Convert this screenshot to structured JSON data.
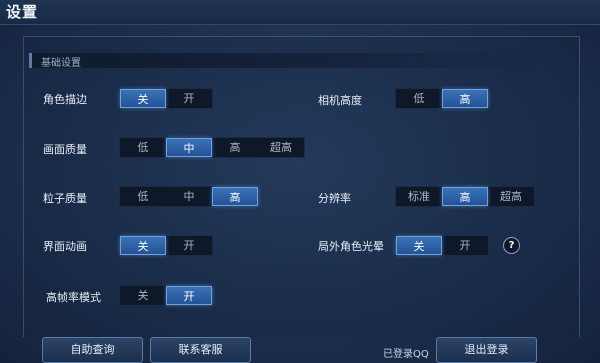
{
  "header": {
    "title": "设置"
  },
  "section": {
    "title": "基础设置"
  },
  "settings": {
    "character_outline": {
      "label": "角色描边",
      "options": [
        "关",
        "开"
      ],
      "selected": "关"
    },
    "camera_height": {
      "label": "相机高度",
      "options": [
        "低",
        "高"
      ],
      "selected": "高"
    },
    "image_quality": {
      "label": "画面质量",
      "options": [
        "低",
        "中",
        "高",
        "超高"
      ],
      "selected": "中"
    },
    "particle_quality": {
      "label": "粒子质量",
      "options": [
        "低",
        "中",
        "高"
      ],
      "selected": "高"
    },
    "resolution": {
      "label": "分辨率",
      "options": [
        "标准",
        "高",
        "超高"
      ],
      "selected": "高"
    },
    "ui_animation": {
      "label": "界面动画",
      "options": [
        "关",
        "开"
      ],
      "selected": "关"
    },
    "outside_glow": {
      "label": "局外角色光晕",
      "options": [
        "关",
        "开"
      ],
      "selected": "关",
      "help": "?"
    },
    "high_fps": {
      "label": "高帧率模式",
      "options": [
        "关",
        "开"
      ],
      "selected": "开"
    }
  },
  "footer": {
    "self_help_button": "自助查询",
    "contact_button": "联系客服",
    "login_status": "已登录QQ",
    "logout_button": "退出登录"
  },
  "colors": {
    "accent": "#3a72b8",
    "background": "#1c2f4e"
  }
}
